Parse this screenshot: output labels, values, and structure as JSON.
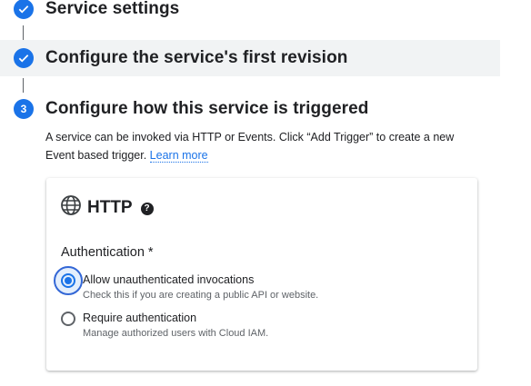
{
  "steps": [
    {
      "title": "Service settings",
      "state": "complete",
      "icon": "check-icon"
    },
    {
      "title": "Configure the service's first revision",
      "state": "complete",
      "icon": "check-icon"
    },
    {
      "title": "Configure how this service is triggered",
      "state": "active",
      "number": "3"
    }
  ],
  "description": {
    "text": "A service can be invoked via HTTP or Events. Click “Add Trigger” to create a new Event based trigger.",
    "link": "Learn more"
  },
  "http_card": {
    "title": "HTTP",
    "icon": "globe-icon",
    "help_icon": "help-icon",
    "help_glyph": "?",
    "auth_label": "Authentication *",
    "options": [
      {
        "label": "Allow unauthenticated invocations",
        "sub": "Check this if you are creating a public API or website.",
        "selected": true
      },
      {
        "label": "Require authentication",
        "sub": "Manage authorized users with Cloud IAM.",
        "selected": false
      }
    ]
  },
  "colors": {
    "accent": "#1a73e8",
    "highlight_row": "#f1f3f4"
  }
}
